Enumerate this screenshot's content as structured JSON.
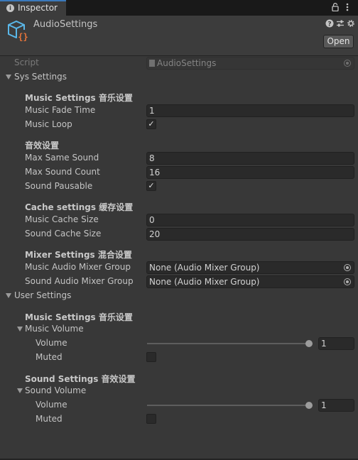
{
  "tab": {
    "label": "Inspector",
    "icon": "info-icon"
  },
  "header": {
    "component_name": "AudioSettings",
    "open_label": "Open",
    "icons": [
      "help-icon",
      "presets-icon",
      "settings-gear-icon",
      "lock-icon",
      "kebab-menu-icon"
    ]
  },
  "script": {
    "label": "Script",
    "value": "AudioSettings"
  },
  "sys_settings": {
    "label": "Sys Settings",
    "music_header": "Music Settings 音乐设置",
    "music_fade_time": {
      "label": "Music Fade Time",
      "value": "1"
    },
    "music_loop": {
      "label": "Music Loop",
      "checked": true
    },
    "sound_header": "音效设置",
    "max_same_sound": {
      "label": "Max Same Sound",
      "value": "8"
    },
    "max_sound_count": {
      "label": "Max Sound Count",
      "value": "16"
    },
    "sound_pausable": {
      "label": "Sound Pausable",
      "checked": true
    },
    "cache_header": "Cache settings 缓存设置",
    "music_cache_size": {
      "label": "Music Cache Size",
      "value": "0"
    },
    "sound_cache_size": {
      "label": "Sound Cache Size",
      "value": "20"
    },
    "mixer_header": "Mixer Settings 混合设置",
    "music_mixer_group": {
      "label": "Music Audio Mixer Group",
      "value": "None (Audio Mixer Group)"
    },
    "sound_mixer_group": {
      "label": "Sound Audio Mixer Group",
      "value": "None (Audio Mixer Group)"
    }
  },
  "user_settings": {
    "label": "User Settings",
    "music_header": "Music Settings 音乐设置",
    "music_volume": {
      "label": "Music Volume",
      "volume_label": "Volume",
      "volume_value": "1",
      "volume_fraction": 1.0,
      "muted_label": "Muted",
      "muted": false
    },
    "sound_header": "Sound Settings 音效设置",
    "sound_volume": {
      "label": "Sound Volume",
      "volume_label": "Volume",
      "volume_value": "1",
      "volume_fraction": 1.0,
      "muted_label": "Muted",
      "muted": false
    }
  },
  "colors": {
    "accent": "#3a79bb",
    "background": "#383838",
    "header": "#3c3c3c",
    "field": "#2a2a2a",
    "script_icon": "#5ab7e8",
    "script_icon_braces": "#e8743a"
  }
}
